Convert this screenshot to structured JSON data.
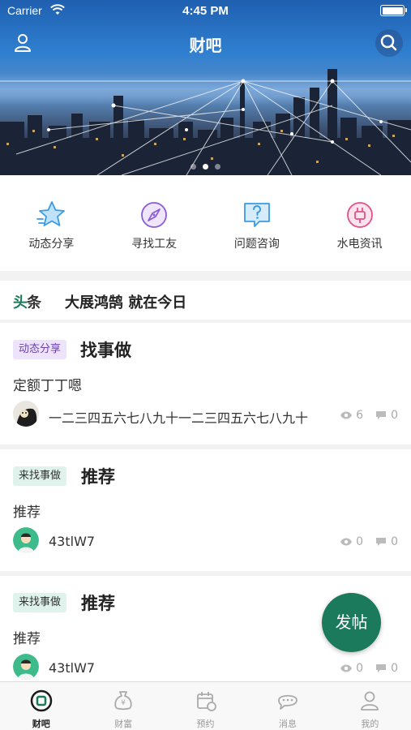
{
  "status_bar": {
    "carrier": "Carrier",
    "time": "4:45 PM"
  },
  "nav": {
    "title": "财吧"
  },
  "banner": {
    "dot_count": 3,
    "active_dot": 1
  },
  "categories": [
    {
      "label": "动态分享",
      "icon": "star-icon",
      "color": "#3a9be6"
    },
    {
      "label": "寻找工友",
      "icon": "compass-icon",
      "color": "#8b5cd6"
    },
    {
      "label": "问题咨询",
      "icon": "question-icon",
      "color": "#3a9be6"
    },
    {
      "label": "水电资讯",
      "icon": "plug-icon",
      "color": "#e2508a"
    }
  ],
  "headline": {
    "tag_a": "头",
    "tag_b": "条",
    "text": "大展鸿鹄 就在今日"
  },
  "posts": [
    {
      "badge": "动态分享",
      "badge_style": "purple",
      "title": "找事做",
      "body": "定额丁丁嗯",
      "author": "一二三四五六七八九十一二三四五六七八九十",
      "views": "6",
      "comments": "0"
    },
    {
      "badge": "来找事做",
      "badge_style": "green",
      "title": "推荐",
      "body": "推荐",
      "author": "43tlW7",
      "views": "0",
      "comments": "0"
    },
    {
      "badge": "来找事做",
      "badge_style": "green",
      "title": "推荐",
      "body": "推荐",
      "author": "43tlW7",
      "views": "0",
      "comments": "0"
    }
  ],
  "fab": {
    "label": "发帖"
  },
  "tabs": [
    {
      "label": "财吧",
      "icon": "home-icon",
      "active": true
    },
    {
      "label": "财富",
      "icon": "money-bag-icon",
      "active": false
    },
    {
      "label": "预约",
      "icon": "calendar-icon",
      "active": false
    },
    {
      "label": "消息",
      "icon": "chat-icon",
      "active": false
    },
    {
      "label": "我的",
      "icon": "profile-icon",
      "active": false
    }
  ],
  "colors": {
    "brand": "#1a7a5b",
    "purple": "#6d3fb0",
    "badge_purple_bg": "#ede4fb",
    "badge_green_bg": "#dff2ec"
  }
}
